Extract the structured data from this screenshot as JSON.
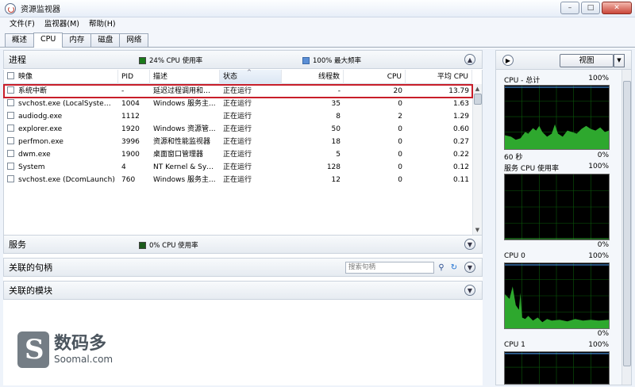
{
  "window": {
    "title": "资源监视器",
    "controls": [
      "–",
      "□",
      "✕"
    ]
  },
  "menu": [
    "文件(F)",
    "监视器(M)",
    "帮助(H)"
  ],
  "tabs": [
    "概述",
    "CPU",
    "内存",
    "磁盘",
    "网络"
  ],
  "active_tab": "CPU",
  "processes": {
    "title": "进程",
    "cpu_usage": "24% CPU 使用率",
    "max_freq": "100% 最大频率",
    "cpu_color": "#1a7a1a",
    "freq_color": "#5b8fd6",
    "columns": [
      "映像",
      "PID",
      "描述",
      "状态",
      "线程数",
      "CPU",
      "平均 CPU"
    ],
    "rows": [
      {
        "image": "系统中断",
        "pid": "-",
        "desc": "延迟过程调用和中...",
        "status": "正在运行",
        "threads": "-",
        "cpu": "20",
        "avg": "13.79"
      },
      {
        "image": "svchost.exe (LocalSystemN...",
        "pid": "1004",
        "desc": "Windows 服务主...",
        "status": "正在运行",
        "threads": "35",
        "cpu": "0",
        "avg": "1.63"
      },
      {
        "image": "audiodg.exe",
        "pid": "1112",
        "desc": "",
        "status": "正在运行",
        "threads": "8",
        "cpu": "2",
        "avg": "1.29"
      },
      {
        "image": "explorer.exe",
        "pid": "1920",
        "desc": "Windows 资源管...",
        "status": "正在运行",
        "threads": "50",
        "cpu": "0",
        "avg": "0.60"
      },
      {
        "image": "perfmon.exe",
        "pid": "3996",
        "desc": "资源和性能监视器",
        "status": "正在运行",
        "threads": "18",
        "cpu": "0",
        "avg": "0.27"
      },
      {
        "image": "dwm.exe",
        "pid": "1900",
        "desc": "桌面窗口管理器",
        "status": "正在运行",
        "threads": "5",
        "cpu": "0",
        "avg": "0.22"
      },
      {
        "image": "System",
        "pid": "4",
        "desc": "NT Kernel & Syst...",
        "status": "正在运行",
        "threads": "128",
        "cpu": "0",
        "avg": "0.12"
      },
      {
        "image": "svchost.exe (DcomLaunch)",
        "pid": "760",
        "desc": "Windows 服务主...",
        "status": "正在运行",
        "threads": "12",
        "cpu": "0",
        "avg": "0.11"
      }
    ]
  },
  "services": {
    "title": "服务",
    "cpu_usage": "0% CPU 使用率"
  },
  "handles": {
    "title": "关联的句柄",
    "search_placeholder": "搜索句柄"
  },
  "modules": {
    "title": "关联的模块"
  },
  "rightpane": {
    "view_label": "视图",
    "graphs": [
      {
        "label": "CPU - 总计",
        "top_pct": "100%",
        "bottom_left": "60 秒",
        "bottom_pct": "0%"
      },
      {
        "label": "服务 CPU 使用率",
        "top_pct": "100%",
        "bottom_left": "",
        "bottom_pct": "0%"
      },
      {
        "label": "CPU 0",
        "top_pct": "100%",
        "bottom_left": "",
        "bottom_pct": "0%"
      },
      {
        "label": "CPU 1",
        "top_pct": "100%",
        "bottom_left": "",
        "bottom_pct": ""
      }
    ]
  },
  "watermark": {
    "cn": "数码多",
    "en": "Soomal.com"
  }
}
